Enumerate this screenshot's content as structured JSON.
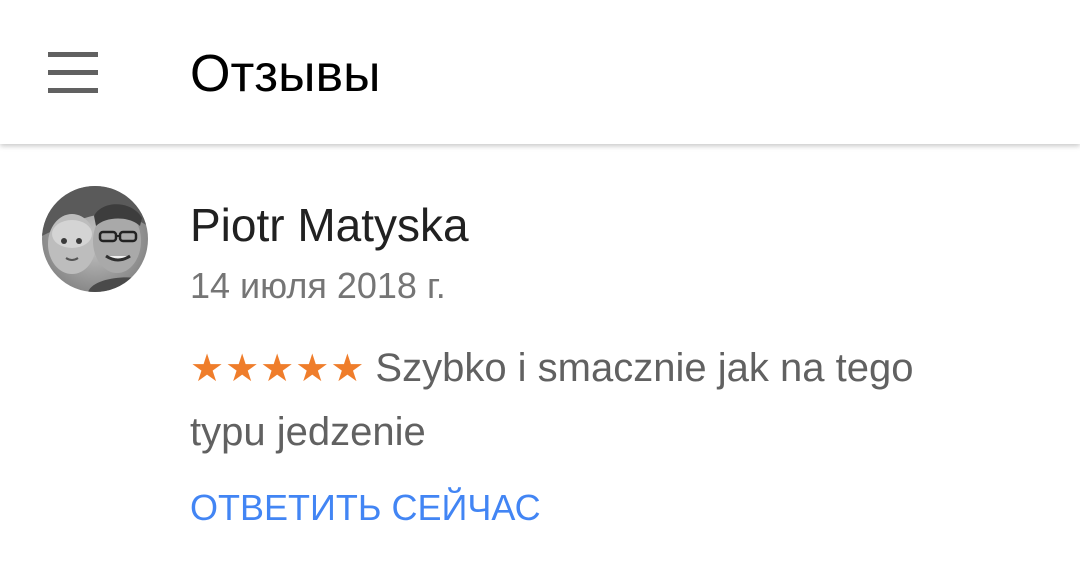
{
  "header": {
    "menu_icon": "hamburger-menu-icon",
    "title": "Отзывы"
  },
  "review": {
    "avatar_icon": "user-avatar",
    "author": "Piotr Matyska",
    "date": "14 июля 2018 г.",
    "rating": 5,
    "rating_max": 5,
    "star_glyph": "★",
    "star_color": "#ef7d2b",
    "text": "Szybko i smacznie jak na tego typu jedzenie",
    "reply_label": "ОТВЕТИТЬ СЕЙЧАС",
    "reply_color": "#4285f4"
  }
}
